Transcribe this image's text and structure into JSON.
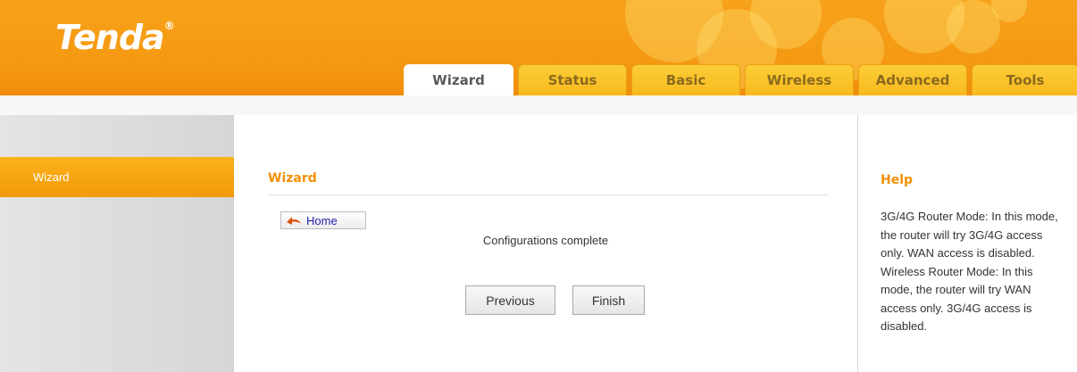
{
  "brand": {
    "logo": "Tenda",
    "registered": "®"
  },
  "tabs": [
    {
      "label": "Wizard",
      "active": true
    },
    {
      "label": "Status"
    },
    {
      "label": "Basic"
    },
    {
      "label": "Wireless"
    },
    {
      "label": "Advanced"
    },
    {
      "label": "Tools"
    }
  ],
  "sidebar": {
    "items": [
      {
        "label": "Wizard",
        "active": true
      }
    ]
  },
  "main": {
    "title": "Wizard",
    "home_label": "Home",
    "status": "Configurations complete",
    "previous_label": "Previous",
    "finish_label": "Finish"
  },
  "help": {
    "title": "Help",
    "text": "3G/4G Router Mode: In this mode, the router will try 3G/4G access only. WAN access is disabled. Wireless Router Mode: In this mode, the router will try WAN access only. 3G/4G access is disabled."
  },
  "colors": {
    "accent": "#f39908",
    "title": "#f29106",
    "tab": "#f9b91f"
  }
}
